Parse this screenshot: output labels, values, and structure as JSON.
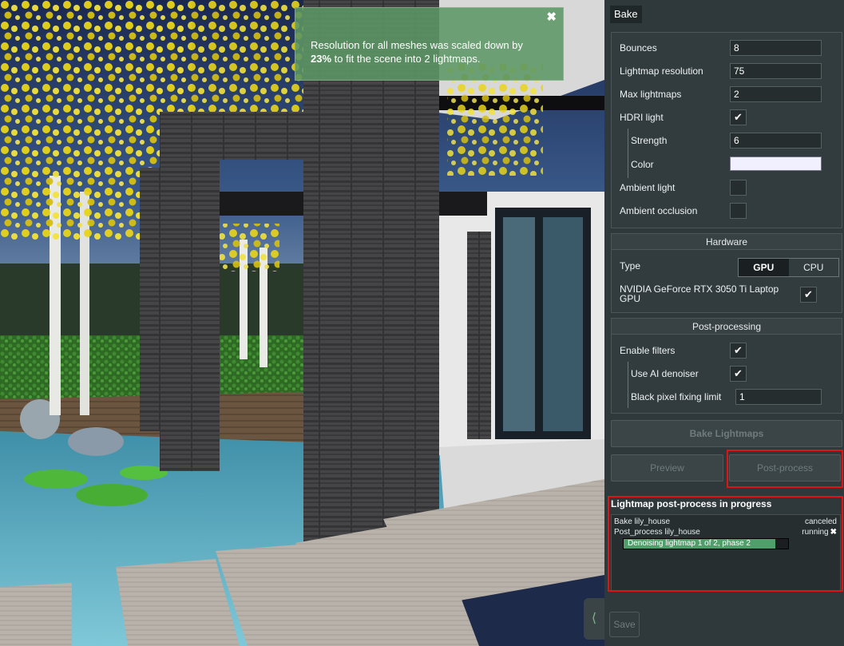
{
  "notification": {
    "line1": "Resolution for all meshes was scaled down by",
    "percent": "23%",
    "line2_rest": " to fit the scene into 2 lightmaps.",
    "close_glyph": "✖"
  },
  "panel": {
    "tab_label": "Bake",
    "settings": {
      "bounces_label": "Bounces",
      "bounces_value": "8",
      "lightmap_resolution_label": "Lightmap resolution",
      "lightmap_resolution_value": "75",
      "max_lightmaps_label": "Max lightmaps",
      "max_lightmaps_value": "2",
      "hdri_light_label": "HDRI light",
      "hdri_light_checked": "✔",
      "strength_label": "Strength",
      "strength_value": "6",
      "color_label": "Color",
      "color_value": "#f0f0ff",
      "ambient_light_label": "Ambient light",
      "ambient_light_checked": "",
      "ambient_occlusion_label": "Ambient occlusion",
      "ambient_occlusion_checked": ""
    },
    "hardware": {
      "title": "Hardware",
      "type_label": "Type",
      "options": [
        "GPU",
        "CPU"
      ],
      "selected": "GPU",
      "device_label": "NVIDIA GeForce RTX 3050 Ti Laptop GPU",
      "device_checked": "✔"
    },
    "post_processing": {
      "title": "Post-processing",
      "enable_filters_label": "Enable filters",
      "enable_filters_checked": "✔",
      "ai_denoiser_label": "Use AI denoiser",
      "ai_denoiser_checked": "✔",
      "black_pixel_label": "Black pixel fixing limit",
      "black_pixel_value": "1"
    },
    "buttons": {
      "bake": "Bake Lightmaps",
      "preview": "Preview",
      "post_process": "Post-process",
      "save": "Save"
    },
    "progress": {
      "title": "Lightmap post-process in progress",
      "jobs": [
        {
          "name": "Bake lily_house",
          "status": "canceled",
          "closable": false
        },
        {
          "name": "Post_process lily_house",
          "status": "running",
          "closable": true
        }
      ],
      "progress_text": "Denoising lightmap 1 of 2, phase 2",
      "progress_fraction": 0.92,
      "close_glyph": "✖"
    },
    "collapse_glyph": "⟨"
  }
}
